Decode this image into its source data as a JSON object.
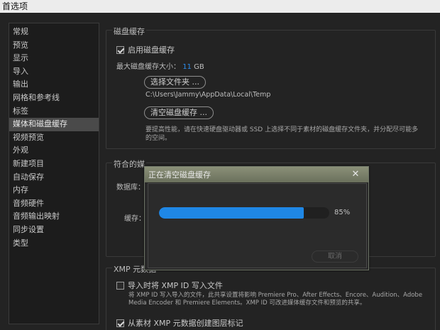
{
  "window": {
    "title": "首选项"
  },
  "sidebar": {
    "items": [
      "常规",
      "预览",
      "显示",
      "导入",
      "输出",
      "网格和参考线",
      "标签",
      "媒体和磁盘缓存",
      "视频预览",
      "外观",
      "新建项目",
      "自动保存",
      "内存",
      "音频硬件",
      "音频输出映射",
      "同步设置",
      "类型"
    ],
    "selected_index": 7
  },
  "disk_cache": {
    "title": "磁盘缓存",
    "enable_label": "启用磁盘缓存",
    "enable_checked": true,
    "max_size_label": "最大磁盘缓存大小：",
    "max_size_value": "11",
    "max_size_unit": "GB",
    "choose_folder_label": "选择文件夹 ...",
    "folder_path": "C:\\Users\\Jammy\\AppData\\Local\\Temp",
    "clear_cache_label": "清空磁盘缓存 ...",
    "help_line1": "要提高性能，请在快速硬盘驱动器或 SSD 上选择不同于素材的磁盘缓存文件夹，并分配尽可能多",
    "help_line2": "的空间。"
  },
  "conformed_media": {
    "title_partial": "符合的媒",
    "database_partial": "数据库：",
    "cache_partial": "缓存："
  },
  "xmp": {
    "title": "XMP 元数据",
    "write_on_import_label": "导入时将 XMP ID 写入文件",
    "write_on_import_checked": false,
    "help_line1": "将 XMP ID 写入导入的文件，此共享设置将影响 Premiere Pro、After Effects、Encore、Audition、Adobe",
    "help_line2": "Media Encoder 和 Premiere Elements。XMP ID 可改进媒体缓存文件和预览的共享。",
    "create_markers_label": "从素材 XMP 元数据创建图层标记",
    "create_markers_checked": true
  },
  "dialog": {
    "title": "正在清空磁盘缓存",
    "progress": 0.85,
    "progress_label": "85%",
    "cancel_label": "取消",
    "close_glyph": "✕"
  }
}
